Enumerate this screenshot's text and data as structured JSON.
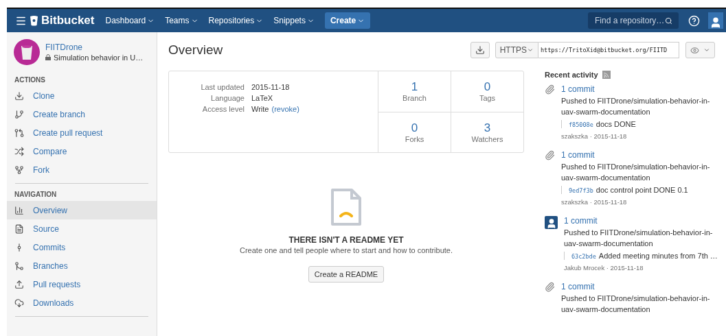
{
  "navbar": {
    "brand": "Bitbucket",
    "menus": [
      {
        "label": "Dashboard"
      },
      {
        "label": "Teams"
      },
      {
        "label": "Repositories"
      },
      {
        "label": "Snippets"
      }
    ],
    "create": "Create",
    "search": {
      "placeholder": "Find a repository…"
    }
  },
  "repo": {
    "owner": "FIITDrone",
    "name": "Simulation behavior in U…"
  },
  "sidebar": {
    "sections": [
      {
        "title": "ACTIONS",
        "items": [
          {
            "label": "Clone",
            "selected": false
          },
          {
            "label": "Create branch",
            "selected": false
          },
          {
            "label": "Create pull request",
            "selected": false
          },
          {
            "label": "Compare",
            "selected": false
          },
          {
            "label": "Fork",
            "selected": false
          }
        ]
      },
      {
        "title": "NAVIGATION",
        "items": [
          {
            "label": "Overview",
            "selected": true
          },
          {
            "label": "Source",
            "selected": false
          },
          {
            "label": "Commits",
            "selected": false
          },
          {
            "label": "Branches",
            "selected": false
          },
          {
            "label": "Pull requests",
            "selected": false
          },
          {
            "label": "Downloads",
            "selected": false
          }
        ]
      }
    ]
  },
  "page_title": "Overview",
  "clone": {
    "protocol": "HTTPS",
    "url": "https://TritoXid@bitbucket.org/FIITD"
  },
  "info": [
    {
      "label": "Last updated",
      "value": "2015-11-18"
    },
    {
      "label": "Language",
      "value": "LaTeX"
    },
    {
      "label": "Access level",
      "value": "Write",
      "link": "(revoke)"
    }
  ],
  "stats": [
    {
      "count": "1",
      "label": "Branch"
    },
    {
      "count": "0",
      "label": "Tags"
    },
    {
      "count": "0",
      "label": "Forks"
    },
    {
      "count": "3",
      "label": "Watchers"
    }
  ],
  "readme": {
    "title": "THERE ISN'T A README YET",
    "text": "Create one and tell people where to start and how to contribute.",
    "button": "Create a README"
  },
  "activity": {
    "title": "Recent activity",
    "items": [
      {
        "kind": "clip",
        "title": "1 commit",
        "text": "Pushed to FIITDrone/simulation-behavior-in-uav-swarm-documentation",
        "hash": "f85008e",
        "message": "docs DONE",
        "meta": "szakszka · 2015-11-18"
      },
      {
        "kind": "clip",
        "title": "1 commit",
        "text": "Pushed to FIITDrone/simulation-behavior-in-uav-swarm-documentation",
        "hash": "9ed7f3b",
        "message": "doc control point DONE 0.1",
        "meta": "szakszka · 2015-11-18"
      },
      {
        "kind": "user",
        "title": "1 commit",
        "text": "Pushed to FIITDrone/simulation-behavior-in-uav-swarm-documentation",
        "hash": "63c2bde",
        "message": "Added meeting minutes from 7th …",
        "meta": "Jakub Mrocek · 2015-11-18"
      },
      {
        "kind": "clip",
        "title": "1 commit",
        "text": "Pushed to FIITDrone/simulation-behavior-in-uav-swarm-documentation"
      }
    ]
  }
}
